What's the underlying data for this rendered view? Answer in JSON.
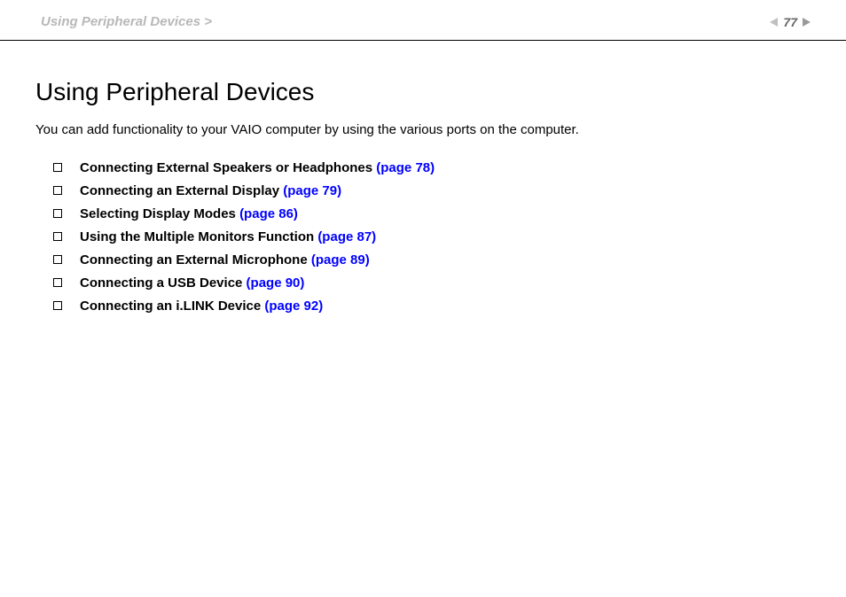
{
  "header": {
    "breadcrumb": "Using Peripheral Devices >",
    "page_number": "77"
  },
  "content": {
    "title": "Using Peripheral Devices",
    "intro": "You can add functionality to your VAIO computer by using the various ports on the computer.",
    "toc_items": [
      {
        "title": "Connecting External Speakers or Headphones ",
        "page_ref": "(page 78)"
      },
      {
        "title": "Connecting an External Display ",
        "page_ref": "(page 79)"
      },
      {
        "title": "Selecting Display Modes ",
        "page_ref": "(page 86)"
      },
      {
        "title": "Using the Multiple Monitors Function ",
        "page_ref": "(page 87)"
      },
      {
        "title": "Connecting an External Microphone ",
        "page_ref": "(page 89)"
      },
      {
        "title": "Connecting a USB Device ",
        "page_ref": "(page 90)"
      },
      {
        "title": "Connecting an i.LINK Device ",
        "page_ref": "(page 92)"
      }
    ]
  }
}
